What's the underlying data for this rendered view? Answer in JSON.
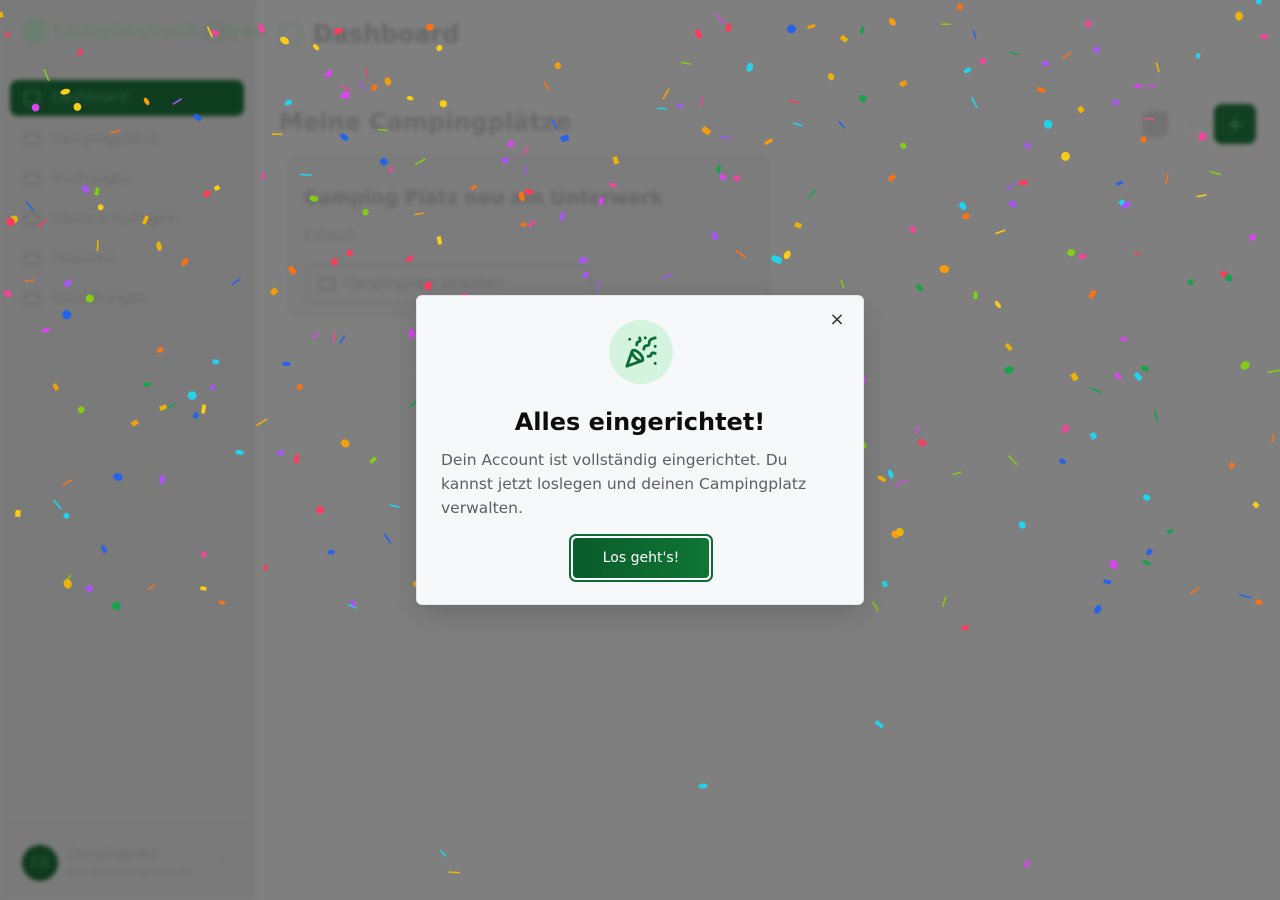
{
  "sidebar": {
    "brand": "Campingbuchungen",
    "items": [
      {
        "label": "Dashboard",
        "active": true
      },
      {
        "label": "Campingplätze"
      },
      {
        "label": "Buchungen"
      },
      {
        "label": "Gäste & Anfragen"
      },
      {
        "label": "Finanzen"
      },
      {
        "label": "Einstellungen"
      }
    ],
    "user": {
      "initials": "CB",
      "name": "Campingplatz",
      "email": "info@campingplatz.de"
    }
  },
  "header": {
    "title": "Dashboard",
    "page_title": "Meine Campingplätze"
  },
  "card": {
    "title": "Camping Platz neu am Unterwerk",
    "subtitle": "Entwurf",
    "button": "Campingplatz verwalten"
  },
  "modal": {
    "icon": "party-popper-icon",
    "close": "×",
    "title": "Alles eingerichtet!",
    "text": "Dein Account ist vollständig eingerichtet. Du kannst jetzt loslegen und deinen Campingplatz verwalten.",
    "button": "Los geht's!"
  },
  "colors": {
    "accent": "#0a6b34",
    "accent_light": "#d4f4e0",
    "overlay": "#7f7f7f",
    "confetti": [
      "#2563eb",
      "#16a34a",
      "#eab308",
      "#f59e0b",
      "#ec4899",
      "#a855f7",
      "#22d3ee",
      "#f43f5e",
      "#84cc16",
      "#f97316",
      "#d946ef",
      "#facc15"
    ]
  }
}
